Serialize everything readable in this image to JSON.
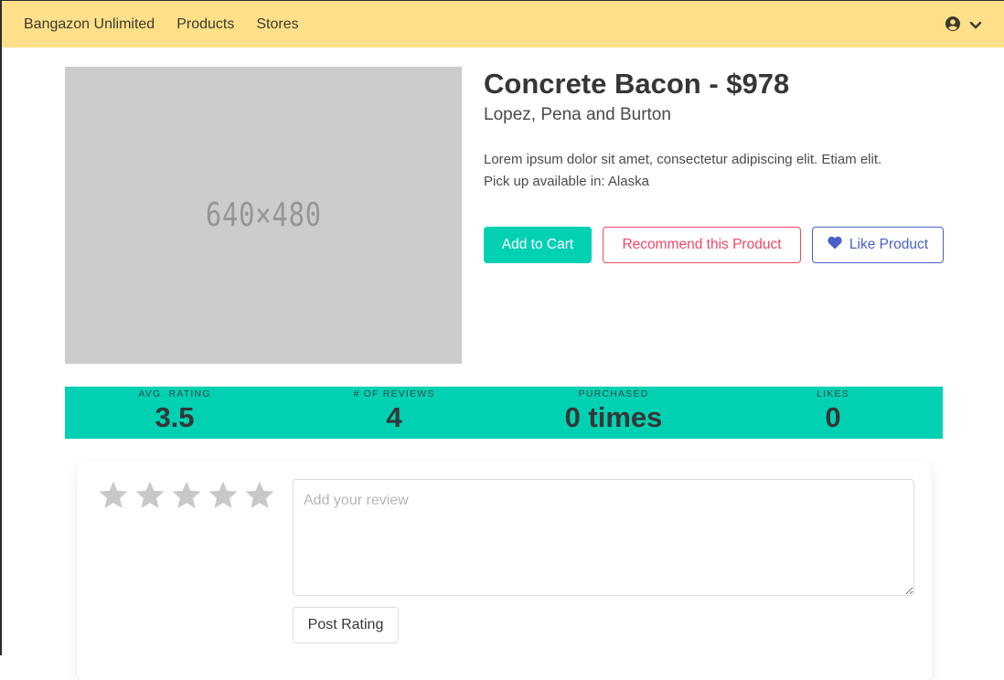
{
  "navbar": {
    "brand": "Bangazon Unlimited",
    "items": [
      "Products",
      "Stores"
    ],
    "user_icon": "user-circle-icon",
    "dropdown_icon": "chevron-down-icon"
  },
  "product": {
    "image_placeholder": "640×480",
    "title": "Concrete Bacon - $978",
    "store": "Lopez, Pena and Burton",
    "description": "Lorem ipsum dolor sit amet, consectetur adipiscing elit. Etiam elit.",
    "pickup": "Pick up available in: Alaska"
  },
  "actions": {
    "add_to_cart": "Add to Cart",
    "recommend": "Recommend this Product",
    "like": "Like Product",
    "like_icon": "heart-icon"
  },
  "stats": [
    {
      "heading": "Avg. Rating",
      "value": "3.5"
    },
    {
      "heading": "# of Reviews",
      "value": "4"
    },
    {
      "heading": "Purchased",
      "value": "0 times"
    },
    {
      "heading": "Likes",
      "value": "0"
    }
  ],
  "review": {
    "star_icon": "star-icon",
    "star_count": 5,
    "placeholder": "Add your review",
    "post_label": "Post Rating"
  },
  "colors": {
    "navbar": "#ffe08a",
    "primary": "#00d1b2",
    "danger": "#f14668",
    "link": "#485fc7",
    "star": "#c8c8c8"
  }
}
